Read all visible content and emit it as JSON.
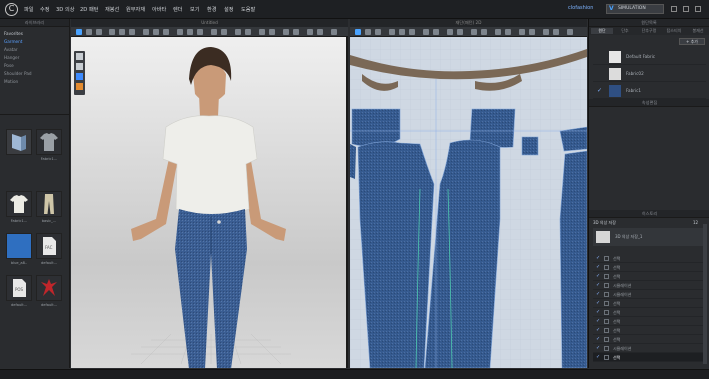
{
  "menu": [
    "파일",
    "수정",
    "3D 의상",
    "2D 패턴",
    "재봉선",
    "원부자재",
    "아바타",
    "렌더",
    "보기",
    "환경",
    "설정",
    "도움말"
  ],
  "user": "clofashion",
  "mode": "SIMULATION",
  "library": {
    "header": "라이브러리",
    "favorites_label": "Favorites",
    "items": [
      "Garment",
      "Avatar",
      "Hanger",
      "Pose",
      "Shoulder Pad",
      "Motion"
    ],
    "thumbs": [
      "",
      "Fabric1...",
      "Fabric1...",
      "basic_...",
      "blue_a8..",
      "default...",
      "default...",
      "default..."
    ]
  },
  "view3d": {
    "title": "Untitled"
  },
  "view2d": {
    "title": "재단(패턴) 2D"
  },
  "object_browser": {
    "header": "원단목록",
    "tabs": [
      "원단",
      "단추",
      "단추구멍",
      "탑스티치",
      "봉재선"
    ],
    "add_label": "+ 추가",
    "fabrics": [
      {
        "name": "Default Fabric",
        "color": "#e6e6e6",
        "checked": false
      },
      {
        "name": "Fabric02",
        "color": "#dcdcdc",
        "checked": false
      },
      {
        "name": "Fabric1",
        "color": "#2f4f82",
        "checked": true
      }
    ]
  },
  "property_header": "속성편집",
  "history": {
    "header": "히스토리",
    "section_label": "3D 의상 저장",
    "count": "12",
    "top_item": "3D 의상 저장_1",
    "rows": [
      "선택",
      "선택",
      "선택",
      "시뮬레이션",
      "시뮬레이션",
      "선택",
      "선택",
      "선택",
      "선택",
      "선택",
      "시뮬레이션",
      "선택"
    ]
  },
  "status_text": "",
  "colors": {
    "accent": "#4aa3ff",
    "denim": "#3a5d92",
    "shirt": "#eeeeea"
  }
}
